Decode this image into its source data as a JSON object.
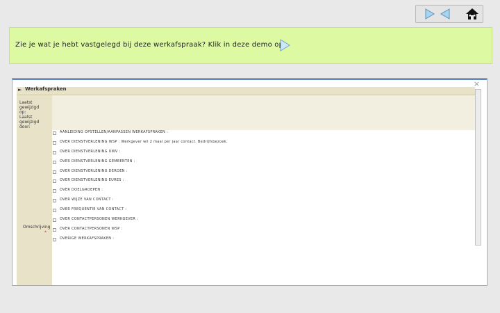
{
  "nav": {
    "next_icon": "play-right-icon",
    "prev_icon": "play-left-icon",
    "home_icon": "home-icon"
  },
  "banner": {
    "text": "Zie je wat je hebt vastgelegd bij deze werkafspraak? Klik in deze demo op",
    "play_icon": "play-right-icon",
    "bg_color": "#ddf9a2"
  },
  "demo": {
    "close_label": "×",
    "tab_label": "Werkafspraken",
    "meta": {
      "line1": "Laatst",
      "line2": "gewijzigd",
      "line3": "op:",
      "line4": "Laatst",
      "line5": "gewijzigd",
      "line6": "door:"
    },
    "side_label": "Omschrijving",
    "side_star": "*",
    "items": [
      {
        "text": "AANLEIDING OPSTELLEN/AANPASSEN WERKAFSPRAKEN :"
      },
      {
        "text": "OVER DIENSTVERLENING WSP :   Werkgever wil 2 maal per jaar contact. Bedrijfsbezoek."
      },
      {
        "text": "OVER DIENSTVERLENING UWV :"
      },
      {
        "text": "OVER DIENSTVERLENING GEMEENTEN :"
      },
      {
        "text": "OVER DIENSTVERLENING DERDEN :"
      },
      {
        "text": "OVER DIENSTVERLENING EURES :"
      },
      {
        "text": "OVER DOELGROEPEN :"
      },
      {
        "text": "OVER WIJZE VAN CONTACT :"
      },
      {
        "text": "OVER FREQUENTIE VAN CONTACT :"
      },
      {
        "text": "OVER CONTACTPERSONEN WERKGEVER :"
      },
      {
        "text": "OVER CONTACTPERSONEN WSP :"
      },
      {
        "text": "OVERIGE WERKAFSPRAKEN :"
      }
    ]
  }
}
